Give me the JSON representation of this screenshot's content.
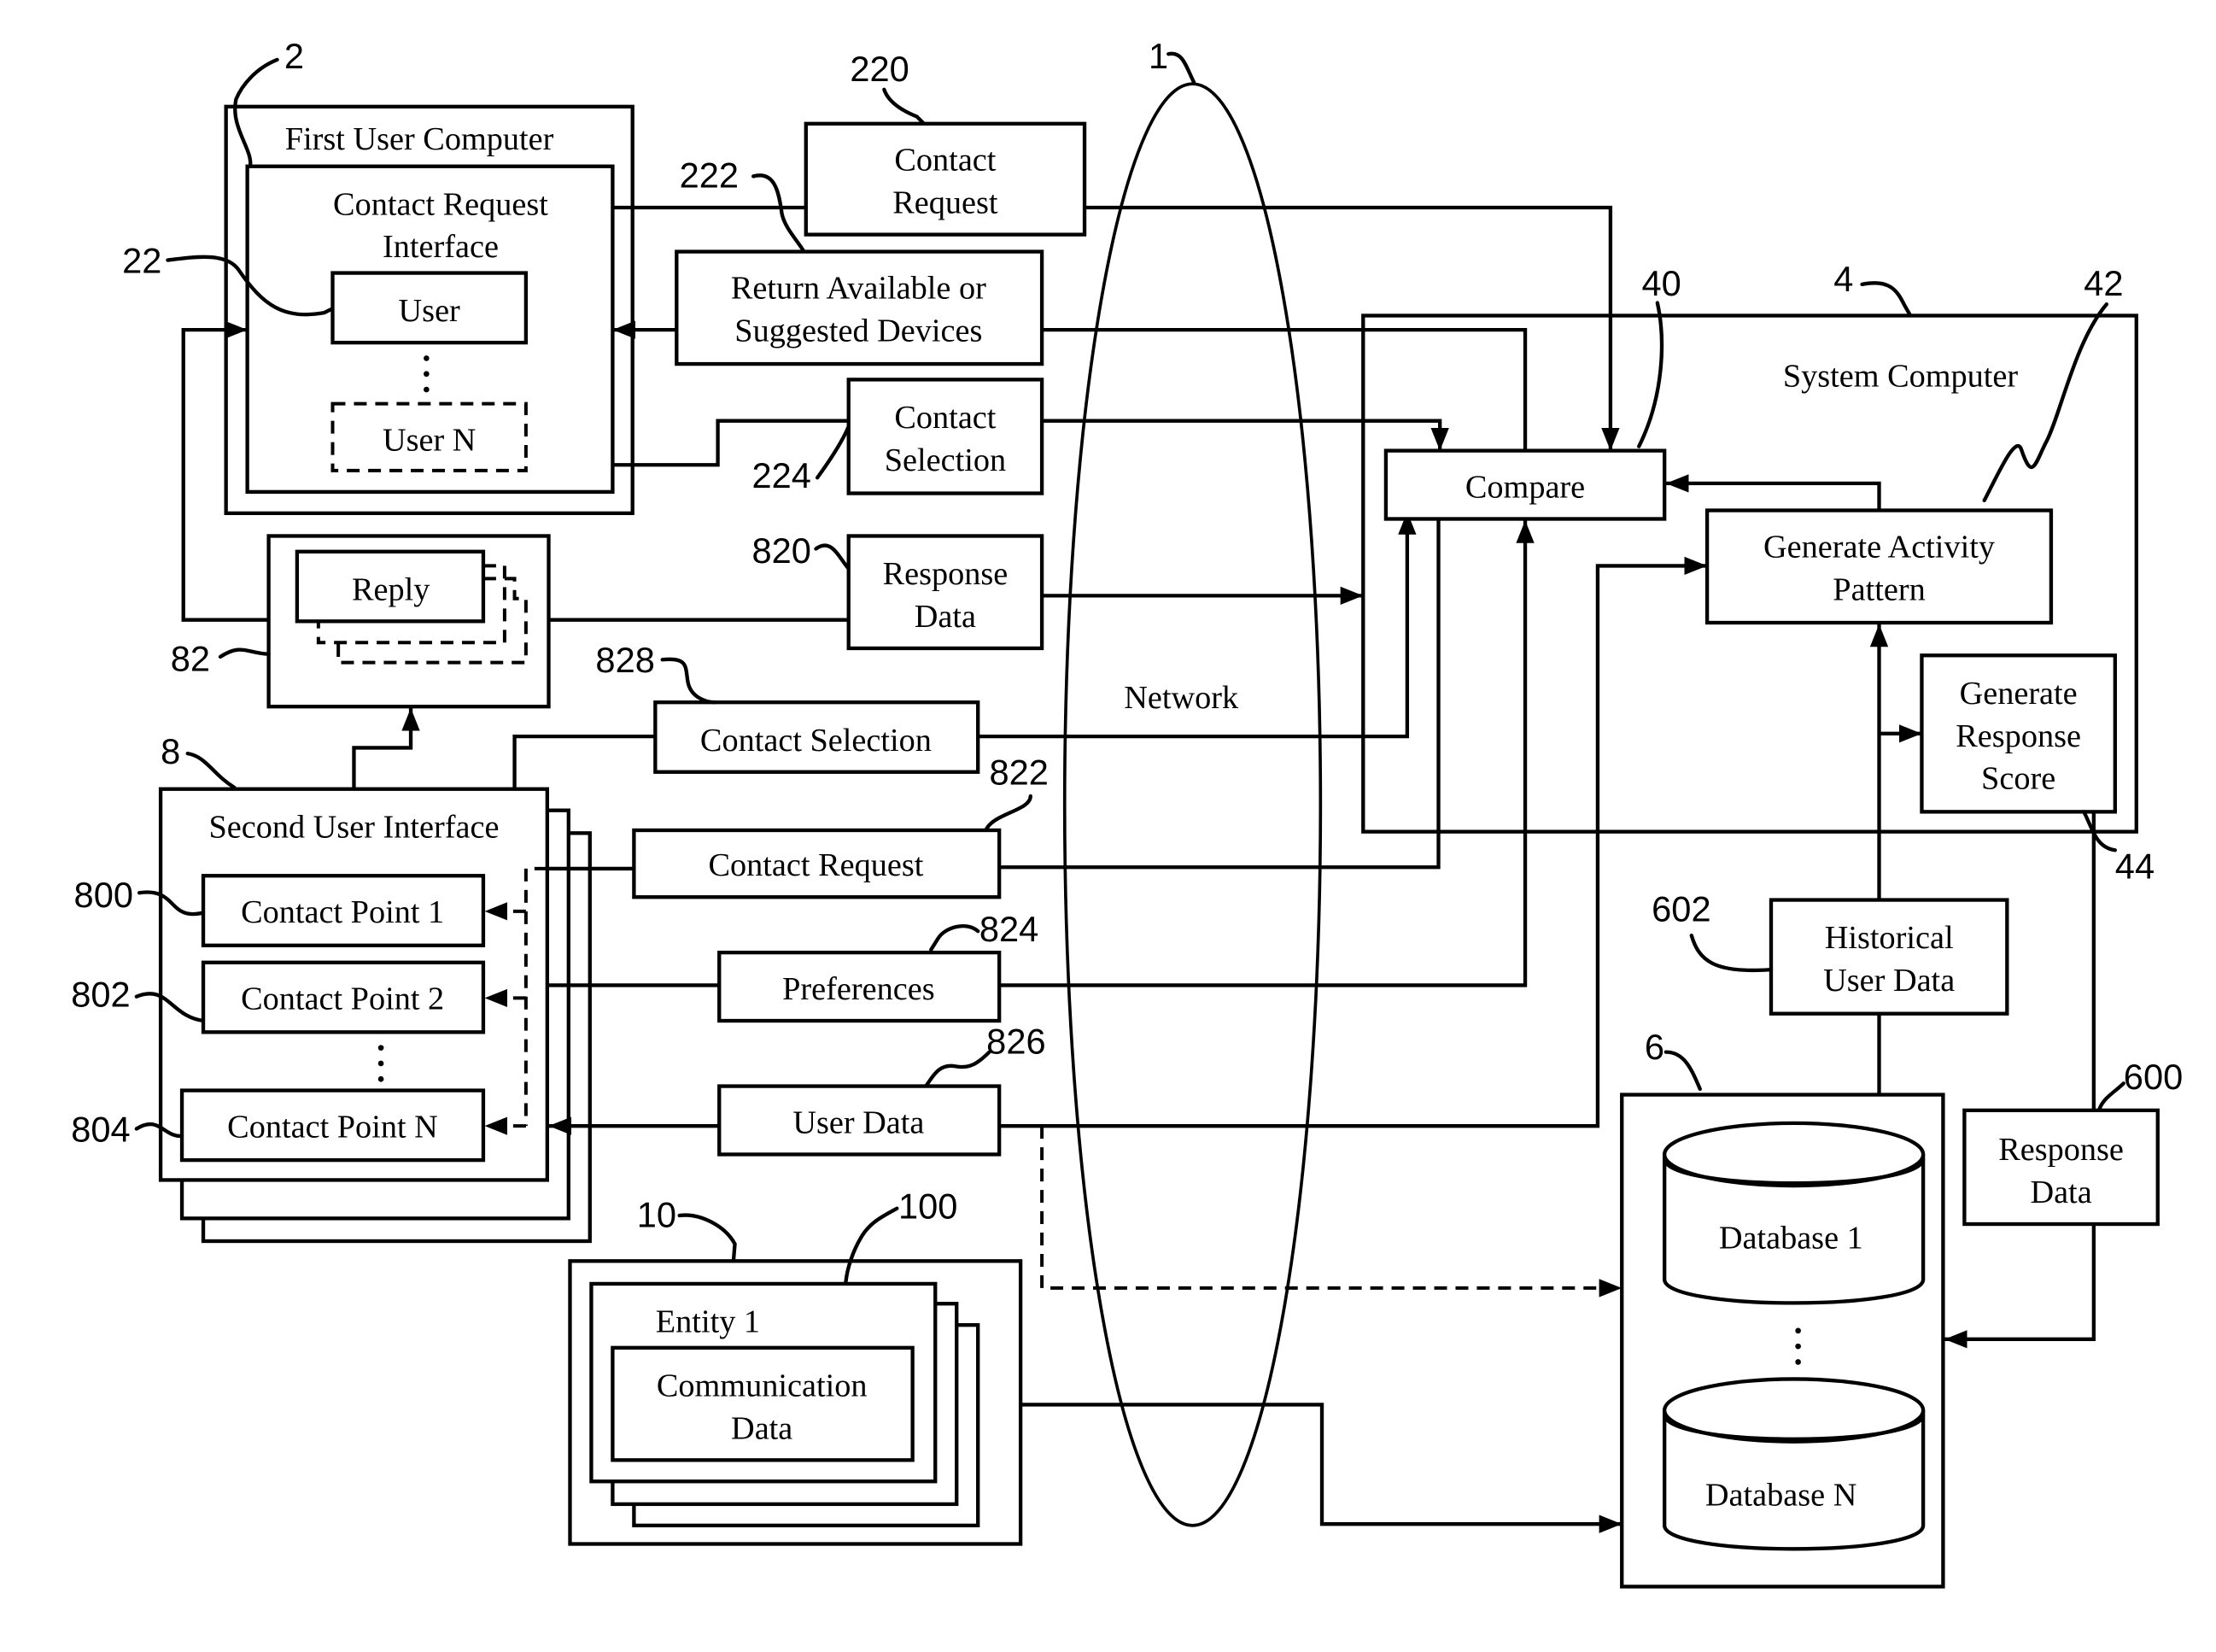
{
  "figure": {
    "network": {
      "label": "Network",
      "ref": "1"
    },
    "first_user_computer": {
      "ref": "2",
      "title": "First User Computer",
      "interface": {
        "title_line1": "Contact Request",
        "title_line2": "Interface",
        "ref": "22"
      },
      "users": [
        "User",
        "User N"
      ]
    },
    "messages_top": [
      {
        "ref": "220",
        "line1": "Contact",
        "line2": "Request"
      },
      {
        "ref": "222",
        "line1": "Return Available or",
        "line2": "Suggested Devices"
      },
      {
        "ref": "224",
        "line1": "Contact",
        "line2": "Selection"
      },
      {
        "ref": "820",
        "line1": "Response",
        "line2": "Data"
      }
    ],
    "reply_box": {
      "ref": "82",
      "label": "Reply"
    },
    "second_user_interface": {
      "ref": "8",
      "title": "Second User Interface",
      "contact_points": [
        {
          "ref": "800",
          "label": "Contact Point 1"
        },
        {
          "ref": "802",
          "label": "Contact Point 2"
        },
        {
          "ref": "804",
          "label": "Contact Point N"
        }
      ]
    },
    "messages_mid": [
      {
        "ref": "828",
        "label": "Contact Selection"
      },
      {
        "ref": "822",
        "label": "Contact Request"
      },
      {
        "ref": "824",
        "label": "Preferences"
      },
      {
        "ref": "826",
        "label": "User Data"
      }
    ],
    "entity": {
      "ref": "10",
      "sub_ref": "100",
      "title": "Entity 1",
      "line1": "Communication",
      "line2": "Data"
    },
    "system_computer": {
      "ref": "4",
      "title": "System Computer",
      "compare": {
        "ref": "40",
        "label": "Compare"
      },
      "activity": {
        "ref": "42",
        "line1": "Generate Activity",
        "line2": "Pattern"
      },
      "score": {
        "ref": "44",
        "line1": "Generate",
        "line2": "Response",
        "line3": "Score"
      }
    },
    "historical": {
      "ref": "602",
      "line1": "Historical",
      "line2": "User Data"
    },
    "database_group": {
      "ref": "6",
      "db1": "Database 1",
      "dbn": "Database N"
    },
    "response_data_db": {
      "ref": "600",
      "line1": "Response",
      "line2": "Data"
    }
  }
}
